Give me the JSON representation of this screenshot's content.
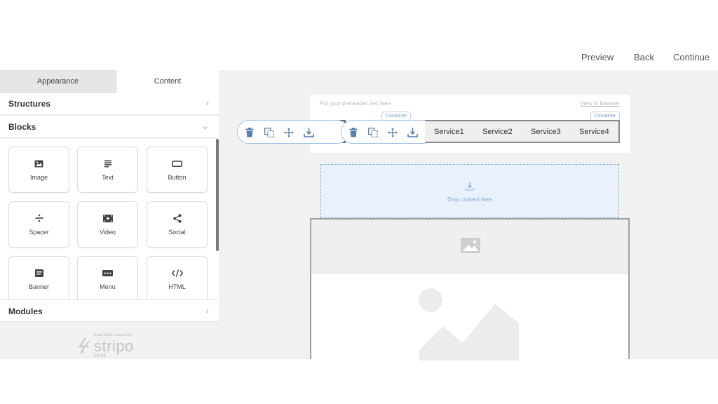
{
  "topbar": {
    "preview": "Preview",
    "back": "Back",
    "continue": "Continue"
  },
  "sidebar": {
    "tabs": {
      "appearance": "Appearance",
      "content": "Content"
    },
    "sections": {
      "structures": "Structures",
      "blocks": "Blocks",
      "modules": "Modules"
    },
    "blocks": [
      {
        "label": "Image",
        "icon": "image-icon"
      },
      {
        "label": "Text",
        "icon": "text-icon"
      },
      {
        "label": "Button",
        "icon": "button-icon"
      },
      {
        "label": "Spacer",
        "icon": "spacer-icon"
      },
      {
        "label": "Video",
        "icon": "video-icon"
      },
      {
        "label": "Social",
        "icon": "share-icon"
      },
      {
        "label": "Banner",
        "icon": "banner-icon"
      },
      {
        "label": "Menu",
        "icon": "menu-icon"
      },
      {
        "label": "HTML",
        "icon": "code-icon"
      }
    ]
  },
  "branding": {
    "tagline": "Email Editor powered by",
    "name": "stripo",
    "sub": "email"
  },
  "canvas": {
    "preheader": "Put your preheader text here",
    "view_in_browser": "View in browser",
    "container_tag": "Container",
    "menu_items": [
      "Service1",
      "Service2",
      "Service3",
      "Service4"
    ],
    "drop_text": "Drop content here"
  },
  "colors": {
    "accent": "#7fb0e8",
    "toolbar_icon": "#5a7fa8",
    "panel_bg": "#f1f1f1"
  }
}
